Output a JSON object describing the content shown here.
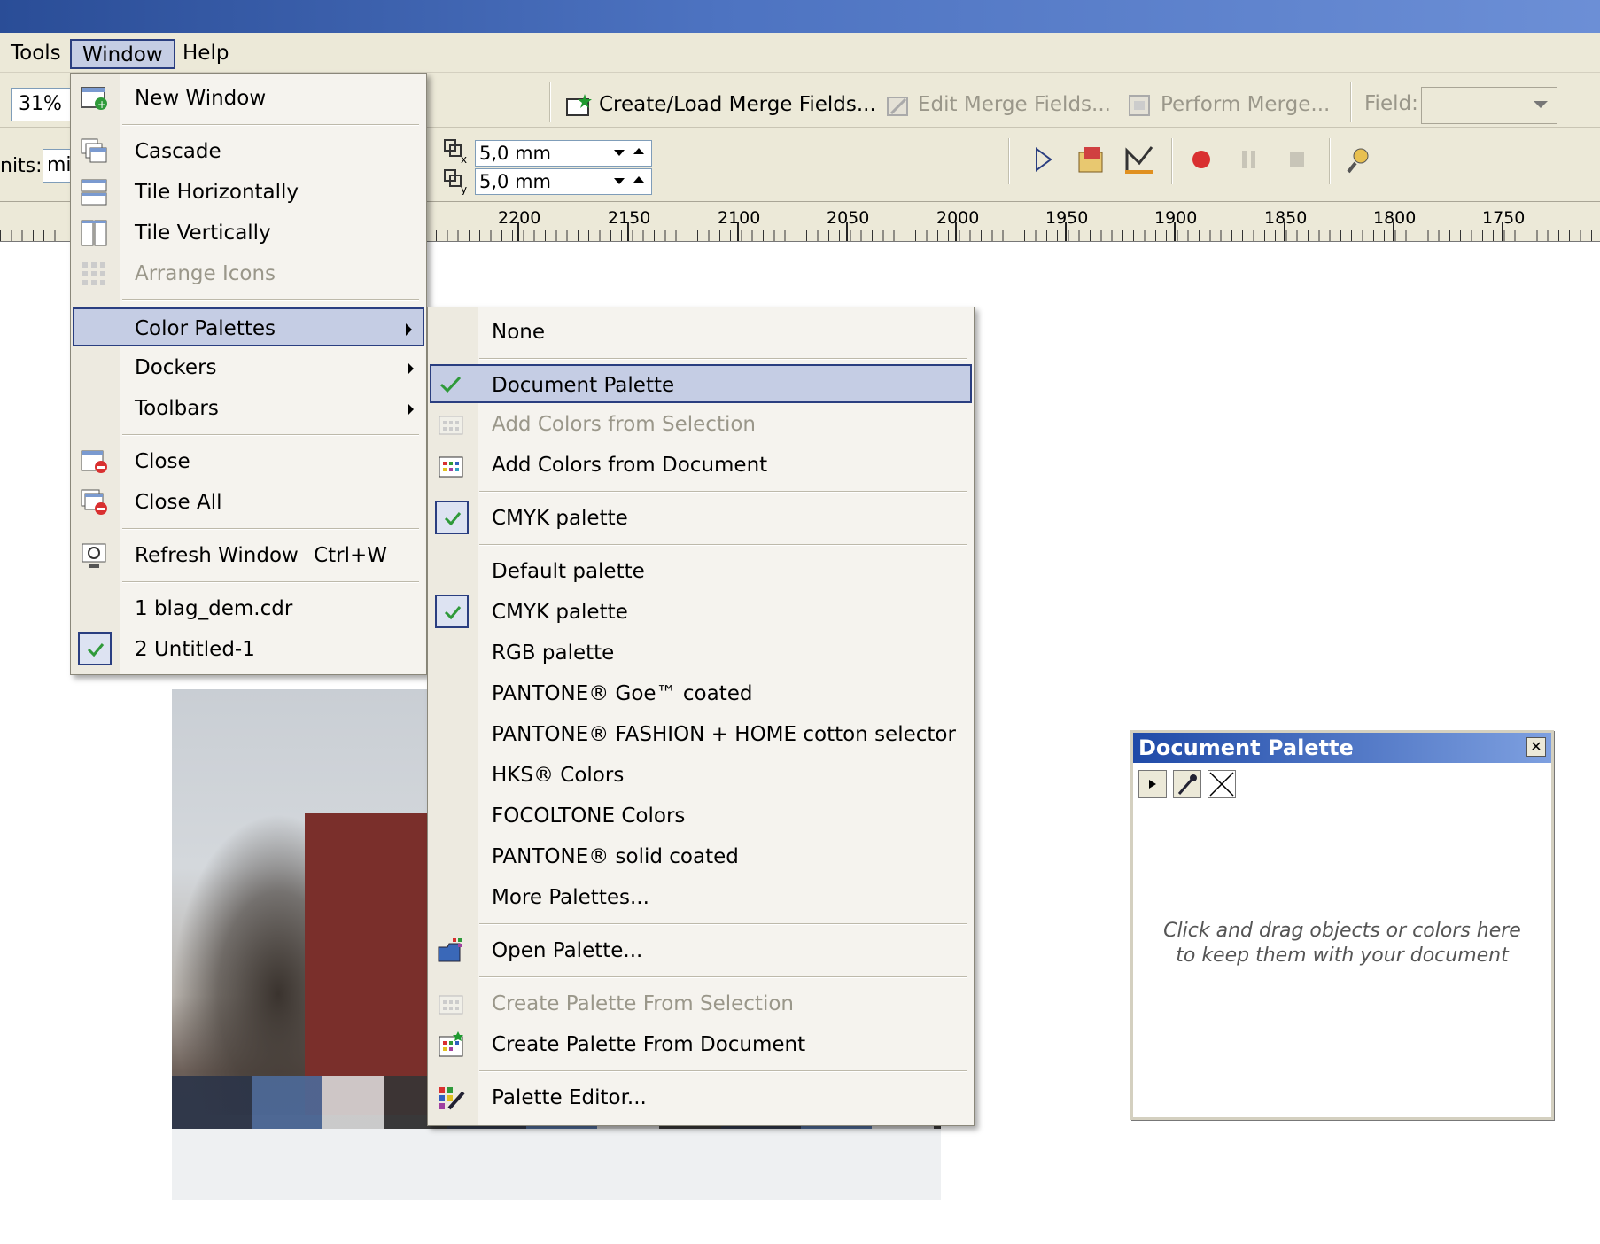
{
  "menubar": {
    "items": [
      {
        "label": "Tools"
      },
      {
        "label": "Window"
      },
      {
        "label": "Help"
      }
    ]
  },
  "toolbar": {
    "zoom": "31%",
    "units_label": "nits:",
    "units_value": "mi",
    "create_merge": "Create/Load Merge Fields...",
    "edit_merge": "Edit Merge Fields...",
    "perform_merge": "Perform Merge...",
    "field_label": "Field:",
    "offset_x": "5,0 mm",
    "offset_y": "5,0 mm"
  },
  "ruler": {
    "labels": [
      "2200",
      "2150",
      "2100",
      "2050",
      "2000",
      "1950",
      "1900",
      "1850",
      "1800",
      "1750"
    ]
  },
  "window_menu": {
    "items": [
      {
        "label": "New Window"
      },
      {
        "label": "Cascade"
      },
      {
        "label": "Tile Horizontally"
      },
      {
        "label": "Tile Vertically"
      },
      {
        "label": "Arrange Icons"
      },
      {
        "label": "Color Palettes"
      },
      {
        "label": "Dockers"
      },
      {
        "label": "Toolbars"
      },
      {
        "label": "Close"
      },
      {
        "label": "Close All"
      },
      {
        "label": "Refresh Window",
        "shortcut": "Ctrl+W"
      },
      {
        "label": "1 blag_dem.cdr"
      },
      {
        "label": "2 Untitled-1"
      }
    ]
  },
  "palette_menu": {
    "items": [
      {
        "label": "None"
      },
      {
        "label": "Document Palette"
      },
      {
        "label": "Add Colors from Selection"
      },
      {
        "label": "Add Colors from Document"
      },
      {
        "label": "CMYK palette"
      },
      {
        "label": "Default palette"
      },
      {
        "label": "CMYK palette"
      },
      {
        "label": "RGB palette"
      },
      {
        "label": "PANTONE® Goe™ coated"
      },
      {
        "label": "PANTONE® FASHION + HOME cotton selector"
      },
      {
        "label": "HKS® Colors"
      },
      {
        "label": "FOCOLTONE Colors"
      },
      {
        "label": "PANTONE® solid coated"
      },
      {
        "label": "More Palettes..."
      },
      {
        "label": "Open Palette..."
      },
      {
        "label": "Create Palette From Selection"
      },
      {
        "label": "Create Palette From Document"
      },
      {
        "label": "Palette Editor..."
      }
    ]
  },
  "docker": {
    "title": "Document Palette",
    "hint": "Click and drag objects or colors here to keep them with your document"
  },
  "colors": {
    "menu_highlight": "#c5cde4",
    "highlight_border": "#2a3e80",
    "check_green": "#2f9a3a"
  }
}
